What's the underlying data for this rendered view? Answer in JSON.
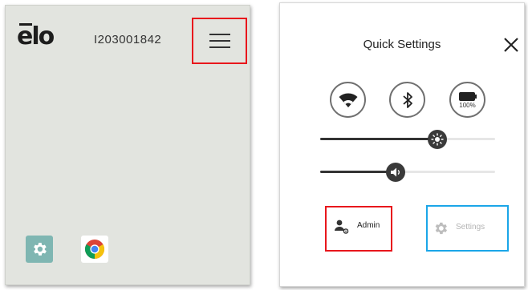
{
  "home": {
    "logo_text": "ēlo",
    "serial_number": "I203001842",
    "menu_icon": "hamburger-menu-icon",
    "apps": [
      {
        "name": "settings",
        "icon": "gear-icon",
        "color": "#7fb6b2"
      },
      {
        "name": "chrome",
        "icon": "chrome-icon"
      }
    ],
    "highlight_color": "#e8161c"
  },
  "quick_settings": {
    "title": "Quick Settings",
    "close_icon": "close-icon",
    "toggles": [
      {
        "name": "wifi",
        "icon": "wifi-icon"
      },
      {
        "name": "bluetooth",
        "icon": "bluetooth-icon"
      },
      {
        "name": "battery",
        "icon": "battery-icon",
        "label": "100%"
      }
    ],
    "brightness_level": 0.67,
    "volume_level": 0.43,
    "admin_label": "Admin",
    "settings_label": "Settings",
    "admin_highlight_color": "#e8161c",
    "settings_highlight_color": "#1ba6e8"
  }
}
